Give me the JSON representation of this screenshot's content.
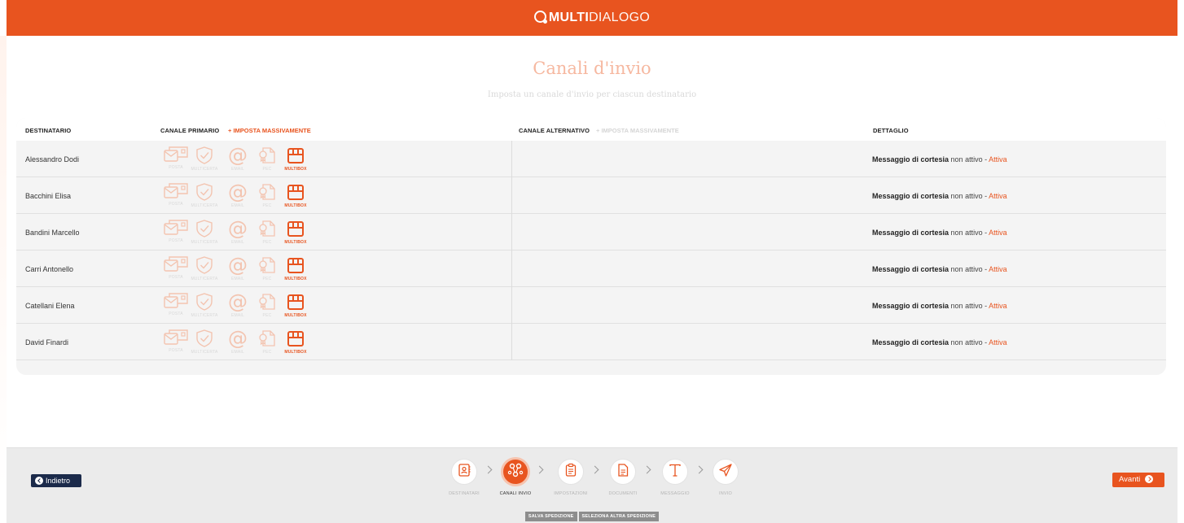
{
  "app": {
    "brand_bold": "MULTI",
    "brand_light": "DIALOGO",
    "accent_color": "#e8541f",
    "navy_color": "#1b2a4a"
  },
  "page": {
    "title": "Canali d'invio",
    "subtitle": "Imposta un canale d'invio per ciascun destinatario"
  },
  "table": {
    "headers": {
      "recipient": "DESTINATARIO",
      "primary": "CANALE PRIMARIO",
      "primary_bulk": "+ IMPOSTA MASSIVAMENTE",
      "alternative": "CANALE ALTERNATIVO",
      "alternative_bulk": "+ IMPOSTA MASSIVAMENTE",
      "detail": "DETTAGLIO"
    },
    "channel_labels": {
      "posta": "POSTA",
      "multicerta": "MULTICERTA",
      "email": "EMAIL",
      "pec": "PEC",
      "multibox": "MULTIBOX"
    },
    "selected_channel": "multibox",
    "detail": {
      "bold": "Messaggio di cortesia",
      "status": "non attivo",
      "separator": "-",
      "action": "Attiva"
    },
    "rows": [
      {
        "name": "Alessandro Dodi"
      },
      {
        "name": "Bacchini Elisa"
      },
      {
        "name": "Bandini Marcello"
      },
      {
        "name": "Carri Antonello"
      },
      {
        "name": "Catellani Elena"
      },
      {
        "name": "David Finardi"
      }
    ]
  },
  "footer": {
    "back_label": "Indietro",
    "next_label": "Avanti",
    "steps": [
      {
        "label": "DESTINATARI",
        "icon": "address-book-icon"
      },
      {
        "label": "CANALI INVIO",
        "icon": "share-nodes-icon",
        "current": true
      },
      {
        "label": "IMPOSTAZIONI",
        "icon": "clipboard-icon"
      },
      {
        "label": "DOCUMENTI",
        "icon": "document-icon"
      },
      {
        "label": "MESSAGGIO",
        "icon": "text-icon"
      },
      {
        "label": "INVIO",
        "icon": "paper-plane-icon"
      }
    ],
    "save_label": "SALVA SPEDIZIONE",
    "select_label": "SELEZIONA ALTRA SPEDIZIONE"
  }
}
